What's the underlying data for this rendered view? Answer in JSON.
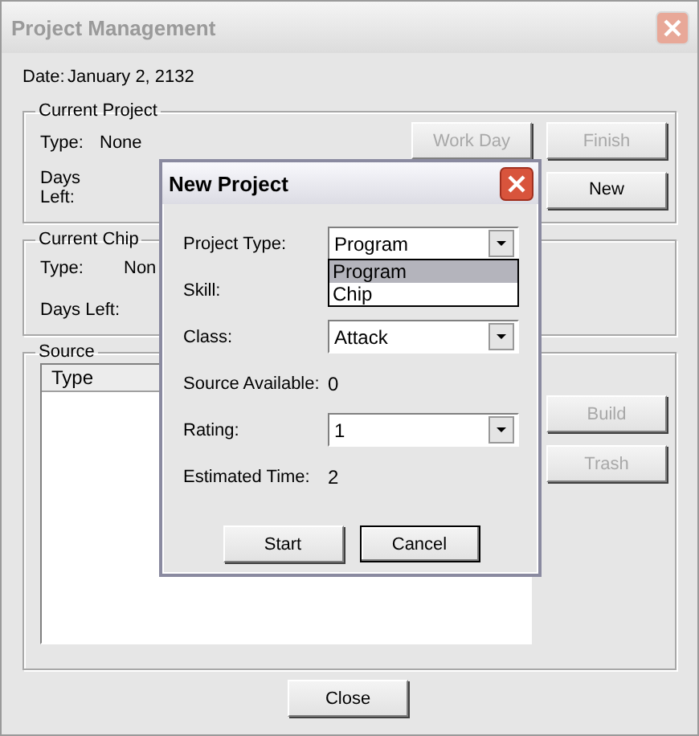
{
  "window": {
    "title": "Project Management",
    "active": false
  },
  "date": {
    "label": "Date:",
    "value": "January 2, 2132"
  },
  "current_project": {
    "title": "Current Project",
    "fields": [
      {
        "label": "Type:",
        "value": "None"
      },
      {
        "label": "Days Left:"
      }
    ],
    "buttons": [
      {
        "label": "Work Day",
        "disabled": true
      },
      {
        "label": "Finish",
        "disabled": true
      },
      {
        "label": "New",
        "disabled": false
      }
    ]
  },
  "current_chip": {
    "title": "Current Chip",
    "fields": [
      {
        "label": "Type:",
        "value": "Non"
      },
      {
        "label": "Days Left:"
      }
    ]
  },
  "source": {
    "title": "Source",
    "columns": [
      "Type"
    ],
    "buttons": [
      {
        "label": "Build",
        "disabled": true
      },
      {
        "label": "Trash",
        "disabled": true
      }
    ]
  },
  "close_button": {
    "label": "Close",
    "disabled": false
  },
  "dialog": {
    "title": "New Project",
    "rows": [
      {
        "kind": "combo",
        "label": "Project Type:",
        "value": "Program",
        "options": [
          {
            "label": "Program",
            "selected": true
          },
          {
            "label": "Chip",
            "selected": false
          }
        ]
      },
      {
        "kind": "text",
        "label": "Skill:"
      },
      {
        "kind": "combo",
        "label": "Class:",
        "value": "Attack"
      },
      {
        "kind": "text",
        "label": "Source Available:",
        "value": "0"
      },
      {
        "kind": "combo",
        "label": "Rating:",
        "value": "1"
      },
      {
        "kind": "text",
        "label": "Estimated Time:",
        "value": "2"
      }
    ],
    "buttons": [
      {
        "label": "Start",
        "focused": false
      },
      {
        "label": "Cancel",
        "focused": true
      }
    ]
  }
}
